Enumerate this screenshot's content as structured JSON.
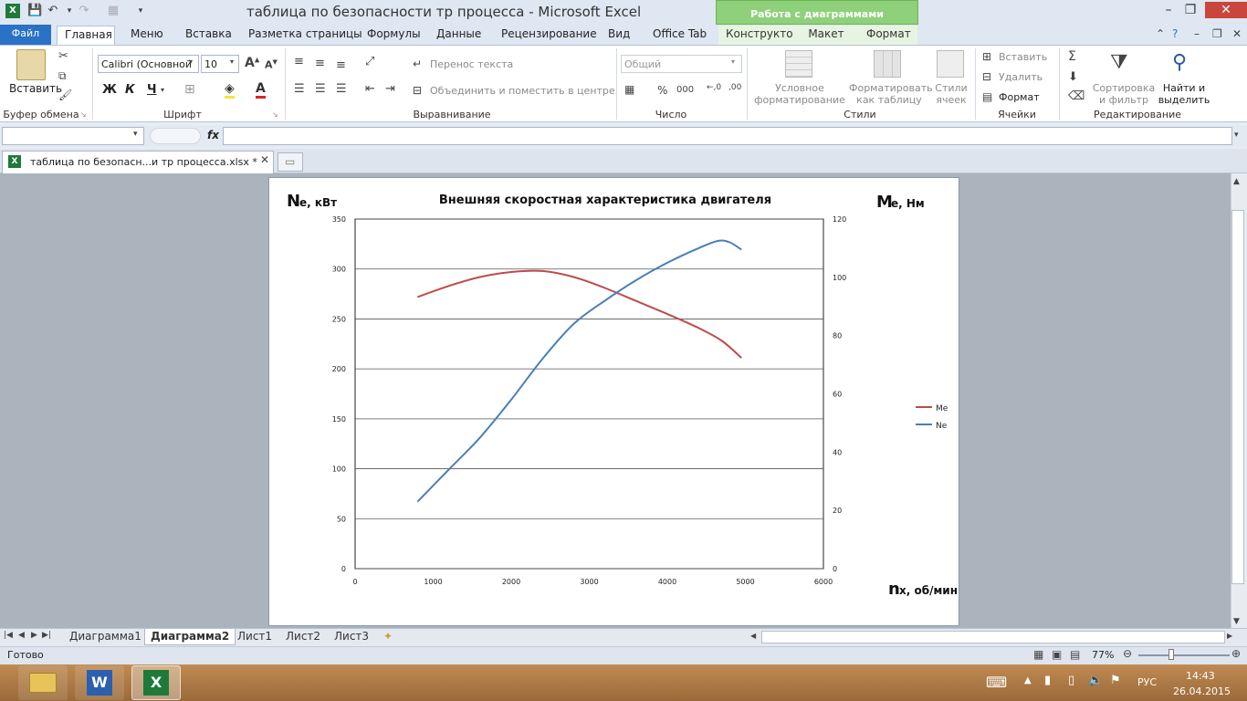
{
  "window": {
    "title": "таблица по безопасности тр процесса  -  Microsoft Excel",
    "context_tab_group": "Работа с диаграммами"
  },
  "tabs": {
    "file": "Файл",
    "home": "Главная",
    "menu": "Меню",
    "insert": "Вставка",
    "layout": "Разметка страницы",
    "formulas": "Формулы",
    "data": "Данные",
    "review": "Рецензирование",
    "view": "Вид",
    "officetab": "Office Tab",
    "constructor": "Конструктор",
    "chart_layout": "Макет",
    "format": "Формат"
  },
  "ribbon": {
    "clipboard": {
      "paste": "Вставить",
      "label": "Буфер обмена"
    },
    "font": {
      "name": "Calibri (Основной",
      "size": "10",
      "bold": "Ж",
      "italic": "К",
      "underline": "Ч",
      "label": "Шрифт"
    },
    "alignment": {
      "wrap": "Перенос текста",
      "merge": "Объединить и поместить в центре",
      "label": "Выравнивание"
    },
    "number": {
      "format": "Общий",
      "label": "Число"
    },
    "styles": {
      "conditional": "Условное форматирование",
      "as_table": "Форматировать как таблицу",
      "cell_styles": "Стили ячеек",
      "label": "Стили"
    },
    "cells": {
      "insert": "Вставить",
      "delete": "Удалить",
      "format": "Формат",
      "label": "Ячейки"
    },
    "editing": {
      "sort": "Сортировка и фильтр",
      "find": "Найти и выделить",
      "label": "Редактирование"
    }
  },
  "formula_bar": {
    "fx": "fx",
    "name": "",
    "value": ""
  },
  "doc_tab": {
    "name": "таблица по безопасн...и тр процесса.xlsx *"
  },
  "chart_data": {
    "type": "line",
    "title": "Внешняя  скоростная характеристика двигателя",
    "y1label_big": "N",
    "y1label_small": "e, кВт",
    "y2label_big": "M",
    "y2label_small": "e, Нм",
    "xlabel_big": "n",
    "xlabel_small": "x, об/мин",
    "xlim": [
      0,
      6000
    ],
    "xticks": [
      0,
      1000,
      2000,
      3000,
      4000,
      5000,
      6000
    ],
    "y1lim": [
      0,
      350
    ],
    "y1ticks": [
      0,
      50,
      100,
      150,
      200,
      250,
      300,
      350
    ],
    "y2lim": [
      0,
      120
    ],
    "y2ticks": [
      0,
      20,
      40,
      60,
      80,
      100,
      120
    ],
    "grid": true,
    "legend_position": "right",
    "series": [
      {
        "name": "Me",
        "axis": "left",
        "color": "#be4b48",
        "points": [
          [
            800,
            272
          ],
          [
            1200,
            283
          ],
          [
            1600,
            292
          ],
          [
            2000,
            297
          ],
          [
            2400,
            298
          ],
          [
            2800,
            292
          ],
          [
            3200,
            281
          ],
          [
            3600,
            268
          ],
          [
            4000,
            255
          ],
          [
            4400,
            241
          ],
          [
            4700,
            228
          ],
          [
            4950,
            211
          ]
        ]
      },
      {
        "name": "Ne",
        "axis": "right",
        "color": "#4a7ebb",
        "points": [
          [
            800,
            23
          ],
          [
            1200,
            34
          ],
          [
            1600,
            45
          ],
          [
            2000,
            58
          ],
          [
            2400,
            72
          ],
          [
            2800,
            84
          ],
          [
            3200,
            92
          ],
          [
            3600,
            99
          ],
          [
            4000,
            105
          ],
          [
            4400,
            110
          ],
          [
            4650,
            112.5
          ],
          [
            4800,
            112
          ],
          [
            4950,
            109.5
          ]
        ]
      }
    ]
  },
  "sheets": {
    "tabs": [
      "Диаграмма1",
      "Диаграмма2",
      "Лист1",
      "Лист2",
      "Лист3"
    ],
    "active": "Диаграмма2"
  },
  "status": {
    "ready": "Готово",
    "zoom": "77%"
  },
  "taskbar": {
    "lang": "РУС",
    "time": "14:43",
    "date": "26.04.2015"
  }
}
